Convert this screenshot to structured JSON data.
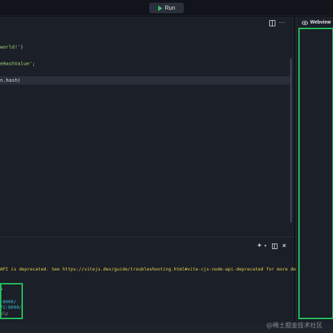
{
  "toolbar": {
    "run_label": "Run"
  },
  "editor": {
    "lines": [
      {
        "plain": "",
        "string": "world!'",
        "tail": ")"
      },
      {
        "plain": "",
        "string": "eHashValue'",
        "tail": ";"
      },
      {
        "plain": "n.hash)",
        "string": "",
        "tail": ""
      }
    ]
  },
  "terminal": {
    "warning": "API is deprecated. See https://vitejs.dev/guide/troubleshooting.html#vite-cjs-node-api-deprecated for more details",
    "line1": "s",
    "line2": ":8000/",
    "line3": "71:8000/",
    "line4": "elp"
  },
  "webview": {
    "tab_label": "Webview"
  },
  "watermark": "@稀土掘金技术社区",
  "colors": {
    "highlight": "#22c55e",
    "run_icon": "#3fbf6a",
    "warning": "#e8d44d",
    "link": "#36c2d8",
    "string": "#9ecf6f"
  }
}
